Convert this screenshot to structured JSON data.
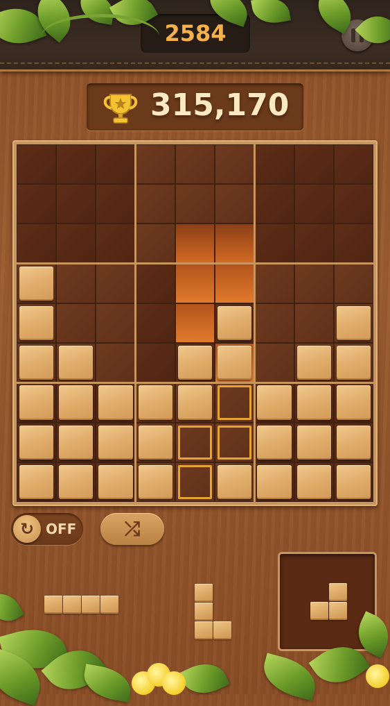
{
  "header": {
    "move_count": "2584",
    "pause_icon": "pause-icon"
  },
  "score": {
    "value": "315,170",
    "icon": "trophy-icon"
  },
  "board": {
    "size": 9,
    "rows": [
      "000000000",
      "000000000",
      "000000000",
      "100000000",
      "100001001",
      "110010011",
      "111110111",
      "111100111",
      "111101111"
    ],
    "floating_tiles": [
      [
        4,
        5
      ],
      [
        5,
        4
      ],
      [
        5,
        5
      ],
      [
        6,
        4
      ]
    ],
    "target_slots": [
      [
        6,
        5
      ],
      [
        7,
        4
      ],
      [
        7,
        5
      ],
      [
        8,
        4
      ]
    ],
    "highlight_columns": [
      4,
      5
    ]
  },
  "controls": {
    "rotate_toggle_label": "OFF",
    "rotate_icon": "rotate-icon",
    "shuffle_icon": "shuffle-icon"
  },
  "tray": {
    "pieces": [
      {
        "name": "I-piece-horizontal",
        "cells": [
          [
            0,
            0
          ],
          [
            0,
            1
          ],
          [
            0,
            2
          ],
          [
            0,
            3
          ]
        ]
      },
      {
        "name": "L-piece",
        "cells": [
          [
            0,
            0
          ],
          [
            1,
            0
          ],
          [
            2,
            0
          ],
          [
            2,
            1
          ]
        ]
      }
    ],
    "hold_piece": {
      "name": "J-piece",
      "cells": [
        [
          0,
          1
        ],
        [
          1,
          1
        ],
        [
          1,
          0
        ]
      ]
    }
  }
}
